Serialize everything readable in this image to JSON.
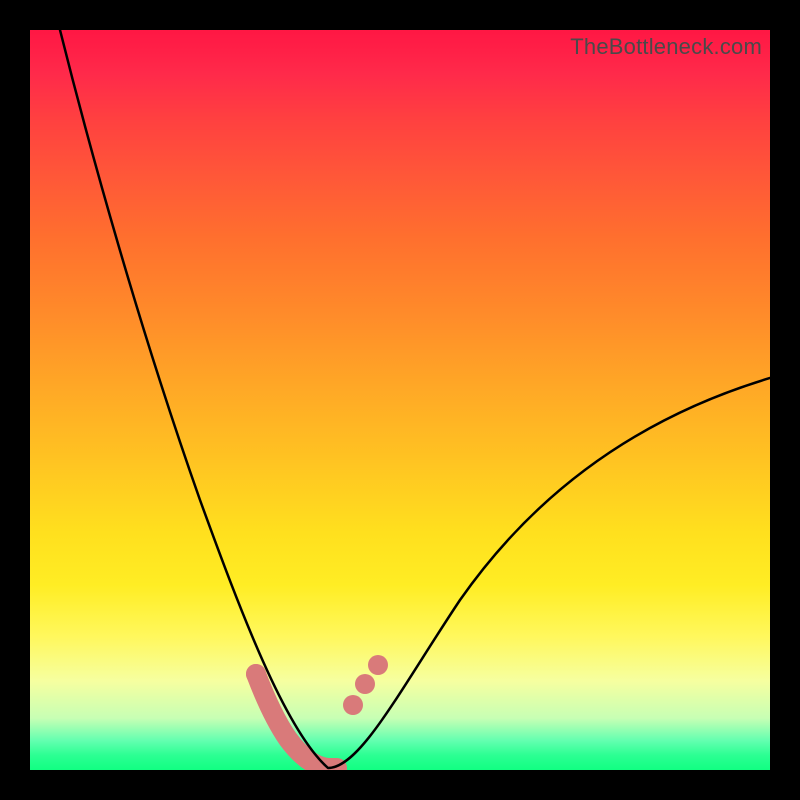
{
  "watermark": "TheBottleneck.com",
  "colors": {
    "frame": "#000000",
    "curve": "#000000",
    "highlight": "#d97a7a",
    "gradient_top": "#ff1744",
    "gradient_mid": "#ffe01e",
    "gradient_bottom": "#11ff82"
  },
  "chart_data": {
    "type": "line",
    "title": "",
    "xlabel": "",
    "ylabel": "",
    "xlim": [
      0,
      100
    ],
    "ylim": [
      0,
      100
    ],
    "grid": false,
    "legend": false,
    "series": [
      {
        "name": "bottleneck-curve",
        "x": [
          4,
          8,
          12,
          16,
          20,
          24,
          28,
          32,
          34,
          36,
          38,
          40,
          42,
          45,
          50,
          55,
          60,
          65,
          70,
          80,
          90,
          100
        ],
        "y": [
          100,
          86,
          72,
          60,
          48,
          37,
          26,
          15,
          10,
          6,
          3,
          1,
          0,
          1,
          4,
          8,
          13,
          18,
          23,
          33,
          43,
          53
        ]
      }
    ],
    "annotations": {
      "optimal_valley": {
        "x": [
          30.5,
          33,
          35,
          37,
          39,
          41.5
        ],
        "y": [
          13,
          8,
          4,
          1.5,
          0.2,
          0.2
        ],
        "style": "thick-stroke"
      },
      "markers": [
        {
          "x": 30.5,
          "y": 13
        },
        {
          "x": 43.6,
          "y": 8.8
        },
        {
          "x": 45.3,
          "y": 11.6
        },
        {
          "x": 47.0,
          "y": 14.2
        }
      ]
    }
  }
}
